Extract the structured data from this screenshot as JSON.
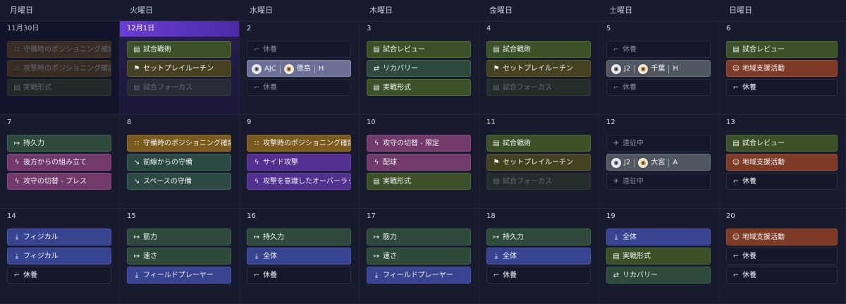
{
  "weekdays": [
    "月曜日",
    "火曜日",
    "水曜日",
    "木曜日",
    "金曜日",
    "土曜日",
    "日曜日"
  ],
  "weeks": [
    [
      {
        "date": "11月30日",
        "state": "past",
        "items": [
          {
            "label": "守備時のポジショニング確認",
            "type": "gold",
            "icon": "positioning-icon"
          },
          {
            "label": "攻撃時のポジショニング確認",
            "type": "gold",
            "icon": "positioning-icon"
          },
          {
            "label": "実戦形式",
            "type": "green",
            "icon": "clipboard-icon"
          }
        ]
      },
      {
        "date": "12月1日",
        "state": "today",
        "items": [
          {
            "label": "試合戦術",
            "type": "green",
            "icon": "clipboard-icon"
          },
          {
            "label": "セットプレイルーチン",
            "type": "olive",
            "icon": "flag-icon"
          },
          {
            "label": "試合フォーカス",
            "type": "dimgreen",
            "icon": "clipboard-icon"
          }
        ]
      },
      {
        "date": "2",
        "items": [
          {
            "label": "休養",
            "type": "dim",
            "icon": "bed-icon"
          },
          {
            "match": true,
            "style": "match",
            "competition": "AJC",
            "team": "徳島",
            "venue": "H",
            "icon": "team-crest-icon"
          },
          {
            "label": "休養",
            "type": "dim",
            "icon": "bed-icon"
          }
        ]
      },
      {
        "date": "3",
        "items": [
          {
            "label": "試合レビュー",
            "type": "green",
            "icon": "clipboard-icon"
          },
          {
            "label": "リカバリー",
            "type": "teal2",
            "icon": "recovery-icon"
          },
          {
            "label": "実戦形式",
            "type": "green",
            "icon": "clipboard-icon"
          }
        ]
      },
      {
        "date": "4",
        "items": [
          {
            "label": "試合戦術",
            "type": "green",
            "icon": "clipboard-icon"
          },
          {
            "label": "セットプレイルーチン",
            "type": "olive",
            "icon": "flag-icon"
          },
          {
            "label": "試合フォーカス",
            "type": "dimgreen",
            "icon": "clipboard-icon"
          }
        ]
      },
      {
        "date": "5",
        "items": [
          {
            "label": "休養",
            "type": "dim",
            "icon": "bed-icon"
          },
          {
            "match": true,
            "style": "match2",
            "competition": "J2",
            "team": "千葉",
            "venue": "H",
            "icon": "team-crest-icon"
          },
          {
            "label": "休養",
            "type": "dim",
            "icon": "bed-icon"
          }
        ]
      },
      {
        "date": "6",
        "items": [
          {
            "label": "試合レビュー",
            "type": "green",
            "icon": "clipboard-icon"
          },
          {
            "label": "地域支援活動",
            "type": "orange",
            "icon": "community-icon"
          },
          {
            "label": "休養",
            "type": "rest",
            "icon": "bed-icon"
          }
        ]
      }
    ],
    [
      {
        "date": "7",
        "items": [
          {
            "label": "持久力",
            "type": "teal2",
            "icon": "stamina-icon"
          },
          {
            "label": "後方からの組み立て",
            "type": "magenta",
            "icon": "lightning-icon"
          },
          {
            "label": "攻守の切替 - プレス",
            "type": "magenta",
            "icon": "lightning-icon"
          }
        ]
      },
      {
        "date": "8",
        "items": [
          {
            "label": "守備時のポジショニング確認",
            "type": "gold",
            "icon": "positioning-icon"
          },
          {
            "label": "前線からの守備",
            "type": "teal",
            "icon": "tackle-icon"
          },
          {
            "label": "スペースの守備",
            "type": "teal",
            "icon": "tackle-icon"
          }
        ]
      },
      {
        "date": "9",
        "items": [
          {
            "label": "攻撃時のポジショニング確認",
            "type": "gold",
            "icon": "positioning-icon"
          },
          {
            "label": "サイド攻撃",
            "type": "purple",
            "icon": "lightning-icon"
          },
          {
            "label": "攻撃を意識したオーバーラップ",
            "type": "purple",
            "icon": "lightning-icon"
          }
        ]
      },
      {
        "date": "10",
        "items": [
          {
            "label": "攻守の切替 - 限定",
            "type": "magenta",
            "icon": "lightning-icon"
          },
          {
            "label": "配球",
            "type": "magenta",
            "icon": "lightning-icon"
          },
          {
            "label": "実戦形式",
            "type": "green",
            "icon": "clipboard-icon"
          }
        ]
      },
      {
        "date": "11",
        "items": [
          {
            "label": "試合戦術",
            "type": "green",
            "icon": "clipboard-icon"
          },
          {
            "label": "セットプレイルーチン",
            "type": "olive",
            "icon": "flag-icon"
          },
          {
            "label": "試合フォーカス",
            "type": "dimgreen",
            "icon": "clipboard-icon"
          }
        ]
      },
      {
        "date": "12",
        "items": [
          {
            "label": "遠征中",
            "type": "dim",
            "icon": "plane-icon"
          },
          {
            "match": true,
            "style": "match2",
            "competition": "J2",
            "team": "大宮",
            "venue": "A",
            "icon": "team-crest-icon"
          },
          {
            "label": "遠征中",
            "type": "dim",
            "icon": "plane-icon"
          }
        ]
      },
      {
        "date": "13",
        "items": [
          {
            "label": "試合レビュー",
            "type": "green",
            "icon": "clipboard-icon"
          },
          {
            "label": "地域支援活動",
            "type": "orange",
            "icon": "community-icon"
          },
          {
            "label": "休養",
            "type": "rest",
            "icon": "bed-icon"
          }
        ]
      }
    ],
    [
      {
        "date": "14",
        "items": [
          {
            "label": "フィジカル",
            "type": "blue",
            "icon": "download-icon"
          },
          {
            "label": "フィジカル",
            "type": "blue",
            "icon": "download-icon"
          },
          {
            "label": "休養",
            "type": "rest",
            "icon": "bed-icon"
          }
        ]
      },
      {
        "date": "15",
        "items": [
          {
            "label": "筋力",
            "type": "teal2",
            "icon": "stamina-icon"
          },
          {
            "label": "速さ",
            "type": "teal2",
            "icon": "stamina-icon"
          },
          {
            "label": "フィールドプレーヤー",
            "type": "blue",
            "icon": "download-icon"
          }
        ]
      },
      {
        "date": "16",
        "items": [
          {
            "label": "持久力",
            "type": "teal2",
            "icon": "stamina-icon"
          },
          {
            "label": "全体",
            "type": "blue",
            "icon": "download-icon"
          },
          {
            "label": "休養",
            "type": "rest",
            "icon": "bed-icon"
          }
        ]
      },
      {
        "date": "17",
        "items": [
          {
            "label": "筋力",
            "type": "teal2",
            "icon": "stamina-icon"
          },
          {
            "label": "速さ",
            "type": "teal2",
            "icon": "stamina-icon"
          },
          {
            "label": "フィールドプレーヤー",
            "type": "blue",
            "icon": "download-icon"
          }
        ]
      },
      {
        "date": "18",
        "items": [
          {
            "label": "持久力",
            "type": "teal2",
            "icon": "stamina-icon"
          },
          {
            "label": "全体",
            "type": "blue",
            "icon": "download-icon"
          },
          {
            "label": "休養",
            "type": "rest",
            "icon": "bed-icon"
          }
        ]
      },
      {
        "date": "19",
        "items": [
          {
            "label": "全体",
            "type": "blue",
            "icon": "download-icon"
          },
          {
            "label": "実戦形式",
            "type": "green",
            "icon": "clipboard-icon"
          },
          {
            "label": "リカバリー",
            "type": "teal2",
            "icon": "recovery-icon"
          }
        ]
      },
      {
        "date": "20",
        "items": [
          {
            "label": "地域支援活動",
            "type": "orange",
            "icon": "community-icon"
          },
          {
            "label": "休養",
            "type": "rest",
            "icon": "bed-icon"
          },
          {
            "label": "休養",
            "type": "rest",
            "icon": "bed-icon"
          }
        ]
      }
    ]
  ],
  "colors": {
    "today_accent": "#6a3dd6",
    "background": "#15172a"
  }
}
